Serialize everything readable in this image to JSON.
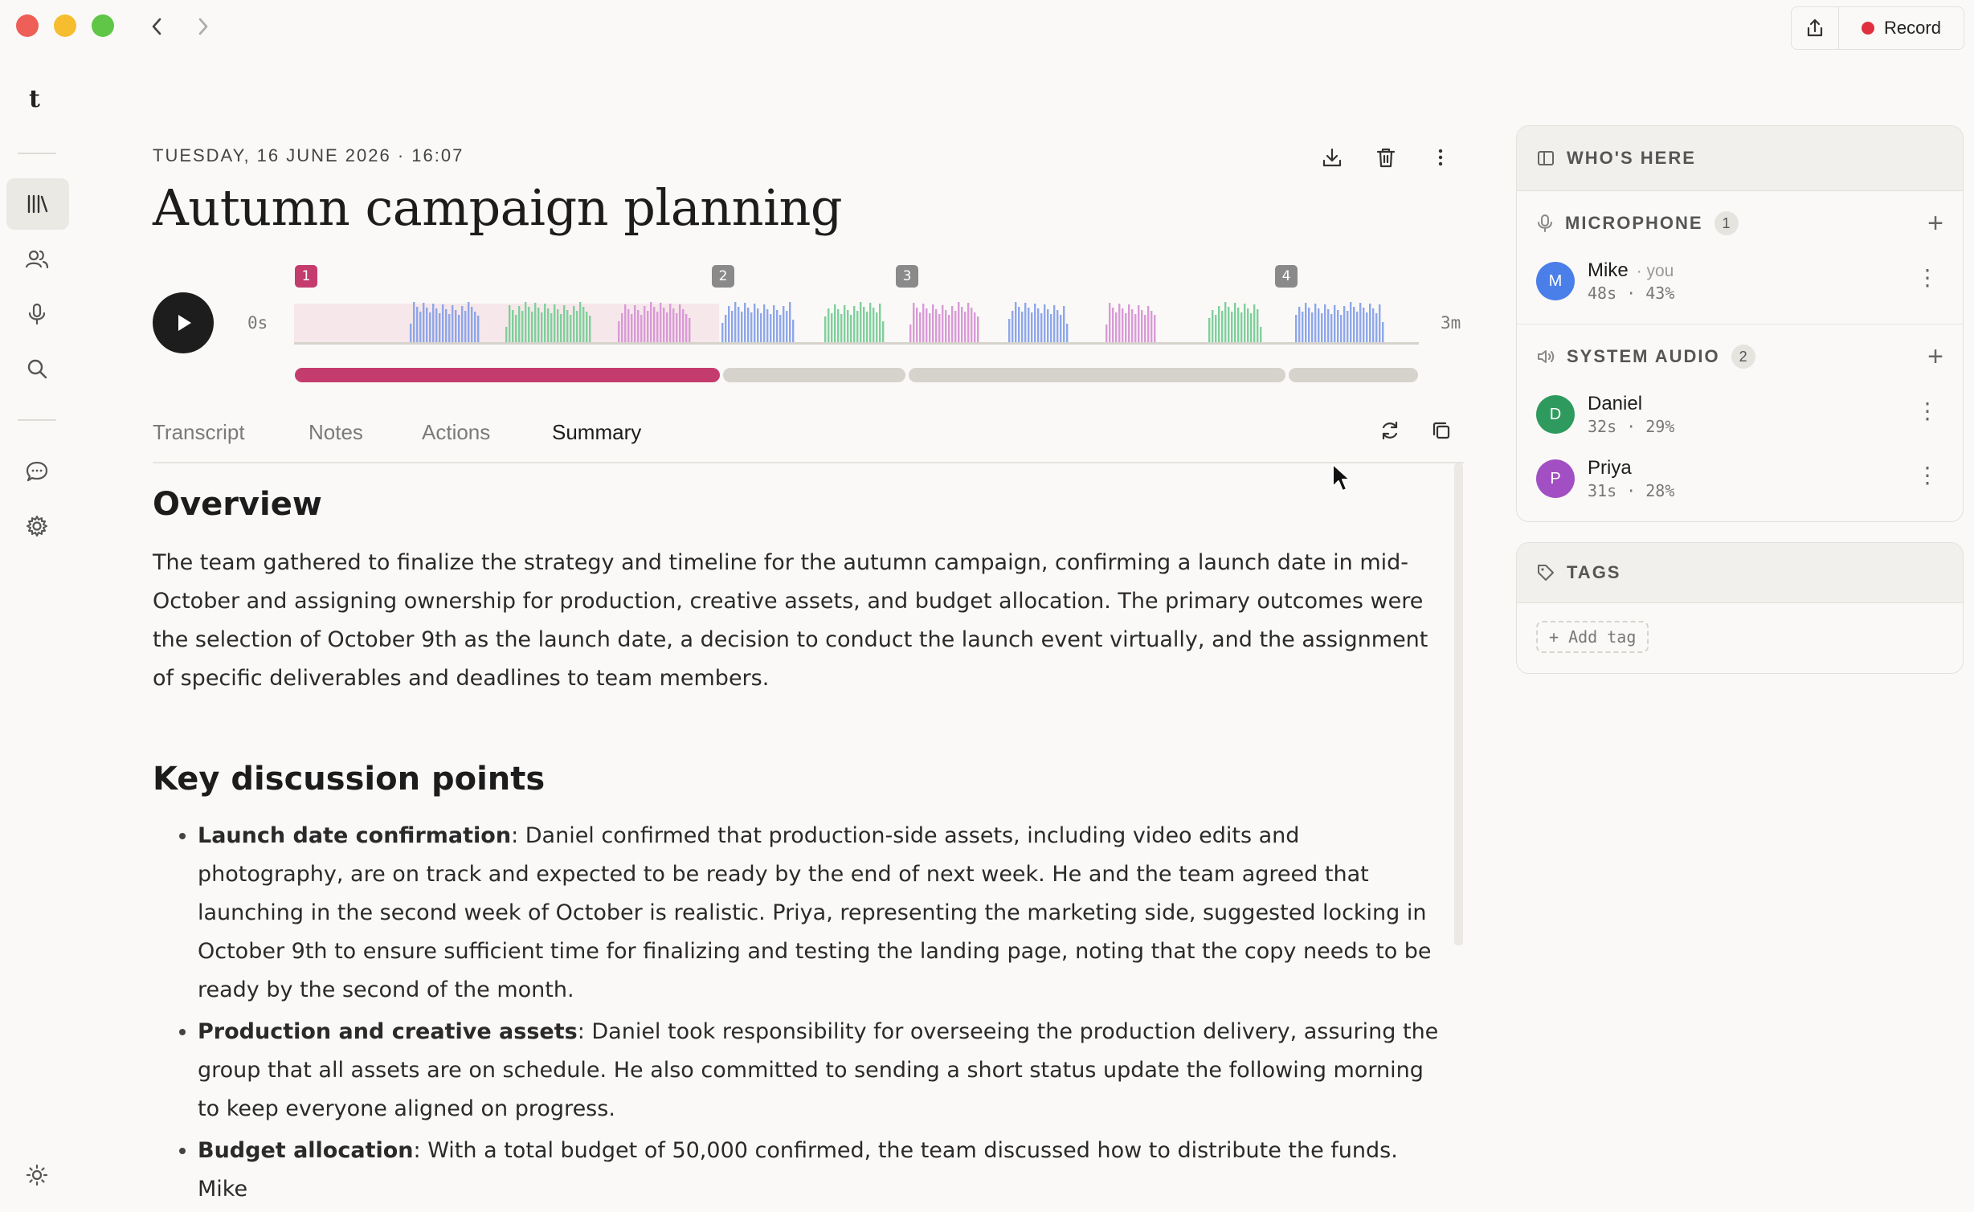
{
  "window": {
    "record_label": "Record"
  },
  "sidebar": {
    "logo": "t"
  },
  "meeting": {
    "date": "TUESDAY, 16 JUNE 2026 · 16:07",
    "title": "Autumn campaign planning"
  },
  "player": {
    "start_label": "0s",
    "end_label": "3m",
    "chapters": [
      "1",
      "2",
      "3",
      "4"
    ],
    "progress": 0.378
  },
  "tabs": [
    {
      "label": "Transcript"
    },
    {
      "label": "Notes"
    },
    {
      "label": "Actions"
    },
    {
      "label": "Summary"
    }
  ],
  "summary": {
    "overview_heading": "Overview",
    "overview_text": "The team gathered to finalize the strategy and timeline for the autumn campaign, confirming a launch date in mid-October and assigning ownership for production, creative assets, and budget allocation. The primary outcomes were the selection of October 9th as the launch date, a decision to conduct the launch event virtually, and the assignment of specific deliverables and deadlines to team members.",
    "key_heading": "Key discussion points",
    "points": [
      {
        "title": "Launch date confirmation",
        "text": ": Daniel confirmed that production-side assets, including video edits and photography, are on track and expected to be ready by the end of next week. He and the team agreed that launching in the second week of October is realistic. Priya, representing the marketing side, suggested locking in October 9th to ensure sufficient time for finalizing and testing the landing page, noting that the copy needs to be ready by the second of the month."
      },
      {
        "title": "Production and creative assets",
        "text": ": Daniel took responsibility for overseeing the production delivery, assuring the group that all assets are on schedule. He also committed to sending a short status update the following morning to keep everyone aligned on progress."
      },
      {
        "title": "Budget allocation",
        "text": ": With a total budget of 50,000 confirmed, the team discussed how to distribute the funds. Mike"
      }
    ]
  },
  "whos_here": {
    "heading": "WHO'S HERE",
    "microphone": {
      "label": "MICROPHONE",
      "count": "1",
      "people": [
        {
          "initial": "M",
          "name": "Mike",
          "you": "you",
          "duration": "48s",
          "share": "43%",
          "color": "#4a7ee8"
        }
      ]
    },
    "system_audio": {
      "label": "SYSTEM AUDIO",
      "count": "2",
      "people": [
        {
          "initial": "D",
          "name": "Daniel",
          "duration": "32s",
          "share": "29%",
          "color": "#2f9a5d"
        },
        {
          "initial": "P",
          "name": "Priya",
          "duration": "31s",
          "share": "28%",
          "color": "#a24fc4"
        }
      ]
    }
  },
  "tags": {
    "heading": "TAGS",
    "add_label": "+ Add tag"
  },
  "colors": {
    "accent": "#c43c6e",
    "track": "#d6d3cd",
    "mike": "#8ea6ea",
    "daniel": "#7fcf9b",
    "priya": "#d99ad7"
  }
}
